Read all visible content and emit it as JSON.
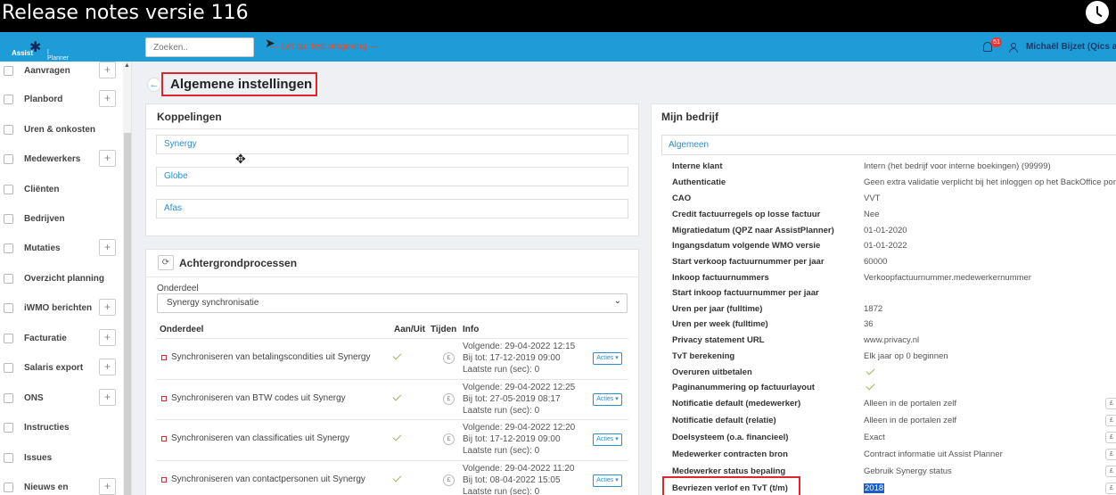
{
  "video": {
    "title": "Release notes versie 116",
    "clock_icon": "clock-icon"
  },
  "header": {
    "logo_brand": "Assist",
    "logo_sub": "| Planner",
    "search_placeholder": "Zoeken..",
    "env_warning": "— Let op: test omgeving —",
    "notification_count": "51",
    "user_name": "Michaël Bijzet (Qics acco"
  },
  "sidebar": {
    "items": [
      {
        "label": "Aanvragen",
        "icon": "inbox-icon",
        "has_plus": true
      },
      {
        "label": "Planbord",
        "icon": "clipboard-icon",
        "has_plus": true
      },
      {
        "label": "Uren & onkosten",
        "icon": "clock-icon",
        "has_plus": false
      },
      {
        "label": "Medewerkers",
        "icon": "users-icon",
        "has_plus": true
      },
      {
        "label": "Cliënten",
        "icon": "person-icon",
        "has_plus": false
      },
      {
        "label": "Bedrijven",
        "icon": "building-icon",
        "has_plus": false
      },
      {
        "label": "Mutaties",
        "icon": "swap-icon",
        "has_plus": true
      },
      {
        "label": "Overzicht planning",
        "icon": "calendar-icon",
        "has_plus": false
      },
      {
        "label": "iWMO berichten",
        "icon": "message-icon",
        "has_plus": true
      },
      {
        "label": "Facturatie",
        "icon": "invoice-icon",
        "has_plus": true
      },
      {
        "label": "Salaris export",
        "icon": "export-icon",
        "has_plus": true
      },
      {
        "label": "ONS",
        "icon": "building-icon",
        "has_plus": true
      },
      {
        "label": "Instructies",
        "icon": "video-icon",
        "has_plus": false
      },
      {
        "label": "Issues",
        "icon": "list-icon",
        "has_plus": false
      },
      {
        "label": "Nieuws en",
        "icon": "news-icon",
        "has_plus": true
      }
    ]
  },
  "page": {
    "title": "Algemene instellingen"
  },
  "koppelingen": {
    "title": "Koppelingen",
    "links": [
      "Synergy",
      "Globe",
      "Afas"
    ]
  },
  "achtergrond": {
    "title": "Achtergrondprocessen",
    "onderdeel_label": "Onderdeel",
    "selected": "Synergy synchronisatie",
    "columns": [
      "Onderdeel",
      "Aan/Uit",
      "Tijden",
      "Info"
    ],
    "rows": [
      {
        "name": "Synchroniseren van betalingscondities uit Synergy",
        "next": "Volgende: 29-04-2022 12:15",
        "until": "Bij tot: 17-12-2019 09:00",
        "last": "Laatste run (sec): 0",
        "actions": "Acties ▾"
      },
      {
        "name": "Synchroniseren van BTW codes uit Synergy",
        "next": "Volgende: 29-04-2022 12:25",
        "until": "Bij tot: 27-05-2019 08:17",
        "last": "Laatste run (sec): 0",
        "actions": "Acties ▾"
      },
      {
        "name": "Synchroniseren van classificaties uit Synergy",
        "next": "Volgende: 29-04-2022 12:20",
        "until": "Bij tot: 17-12-2019 09:00",
        "last": "Laatste run (sec): 0",
        "actions": "Acties ▾"
      },
      {
        "name": "Synchroniseren van contactpersonen uit Synergy",
        "next": "Volgende: 29-04-2022 11:20",
        "until": "Bij tot: 08-04-2022 15:05",
        "last": "Laatste run (sec): 0",
        "actions": "Acties ▾"
      }
    ]
  },
  "bedrijf": {
    "title": "Mijn bedrijf",
    "tab": "Algemeen",
    "rows": [
      {
        "label": "Interne klant",
        "value": "Intern (het bedrijf voor interne boekingen) (99999)"
      },
      {
        "label": "Authenticatie",
        "value": "Geen extra validatie verplicht bij het inloggen op het BackOffice portaal"
      },
      {
        "label": "CAO",
        "value": "VVT"
      },
      {
        "label": "Credit factuurregels op losse factuur",
        "value": "Nee"
      },
      {
        "label": "Migratiedatum (QPZ naar AssistPlanner)",
        "value": "01-01-2020"
      },
      {
        "label": "Ingangsdatum volgende WMO versie",
        "value": "01-01-2022"
      },
      {
        "label": "Start verkoop factuurnummer per jaar",
        "value": "60000"
      },
      {
        "label": "Inkoop factuurnummers",
        "value": "Verkoopfactuurnummer.medewerkernummer"
      },
      {
        "label": "Start inkoop factuurnummer per jaar",
        "value": ""
      },
      {
        "label": "Uren per jaar (fulltime)",
        "value": "1872"
      },
      {
        "label": "Uren per week (fulltime)",
        "value": "36"
      },
      {
        "label": "Privacy statement URL",
        "value": "www.privacy.nl"
      },
      {
        "label": "TvT berekening",
        "value": "Elk jaar op 0 beginnen"
      },
      {
        "label": "Overuren uitbetalen",
        "value": "",
        "check": true
      },
      {
        "label": "Paginanummering op factuurlayout",
        "value": "",
        "check": true
      },
      {
        "label": "Notificatie default (medewerker)",
        "value": "Alleen in de portalen zelf",
        "edit": true
      },
      {
        "label": "Notificatie default (relatie)",
        "value": "Alleen in de portalen zelf",
        "edit": true
      },
      {
        "label": "Doelsysteem (o.a. financieel)",
        "value": "Exact",
        "edit": true
      },
      {
        "label": "Medewerker contracten bron",
        "value": "Contract informatie uit Assist Planner",
        "edit": true
      },
      {
        "label": "Medewerker status bepaling",
        "value": "Gebruik Synergy status",
        "edit": true
      },
      {
        "label": "Bevriezen verlof en TvT (t/m)",
        "value": "2018",
        "edit": true,
        "highlight": true
      }
    ]
  }
}
